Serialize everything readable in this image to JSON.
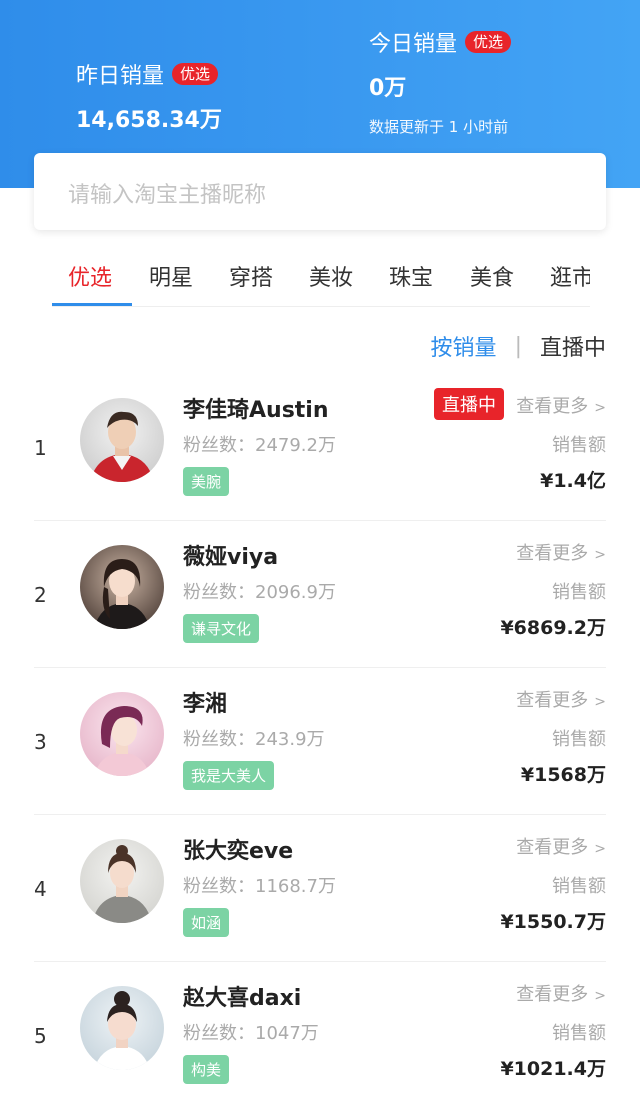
{
  "header": {
    "yesterday": {
      "label": "昨日销量",
      "badge": "优选",
      "value": "14,658.34万"
    },
    "today": {
      "label": "今日销量",
      "badge": "优选",
      "value": "0万",
      "note": "数据更新于 1 小时前"
    },
    "color": "#2f8dea"
  },
  "search": {
    "placeholder": "请输入淘宝主播昵称"
  },
  "tabs": [
    "优选",
    "明星",
    "穿搭",
    "美妆",
    "珠宝",
    "美食",
    "逛市"
  ],
  "active_tab": "优选",
  "sort": {
    "active": "按销量",
    "divider": "|",
    "other": "直播中"
  },
  "anchors": [
    {
      "rank": "1",
      "name": "李佳琦Austin",
      "fans": "粉丝数：2479.2万",
      "tag": "美腕",
      "live": "直播中",
      "more": "查看更多",
      "sales_label": "销售额",
      "sales": "¥1.4亿",
      "avatar": "avatar-1"
    },
    {
      "rank": "2",
      "name": "薇娅viya",
      "fans": "粉丝数：2096.9万",
      "tag": "谦寻文化",
      "live": "",
      "more": "查看更多",
      "sales_label": "销售额",
      "sales": "¥6869.2万",
      "avatar": "avatar-2"
    },
    {
      "rank": "3",
      "name": "李湘",
      "fans": "粉丝数：243.9万",
      "tag": "我是大美人",
      "live": "",
      "more": "查看更多",
      "sales_label": "销售额",
      "sales": "¥1568万",
      "avatar": "avatar-3"
    },
    {
      "rank": "4",
      "name": "张大奕eve",
      "fans": "粉丝数：1168.7万",
      "tag": "如涵",
      "live": "",
      "more": "查看更多",
      "sales_label": "销售额",
      "sales": "¥1550.7万",
      "avatar": "avatar-4"
    },
    {
      "rank": "5",
      "name": "赵大喜daxi",
      "fans": "粉丝数：1047万",
      "tag": "构美",
      "live": "",
      "more": "查看更多",
      "sales_label": "销售额",
      "sales": "¥1021.4万",
      "avatar": "avatar-5"
    }
  ],
  "colors": {
    "accent_red": "#e8242a",
    "accent_blue": "#2f8dea",
    "tag_green": "#7cd3a4"
  }
}
